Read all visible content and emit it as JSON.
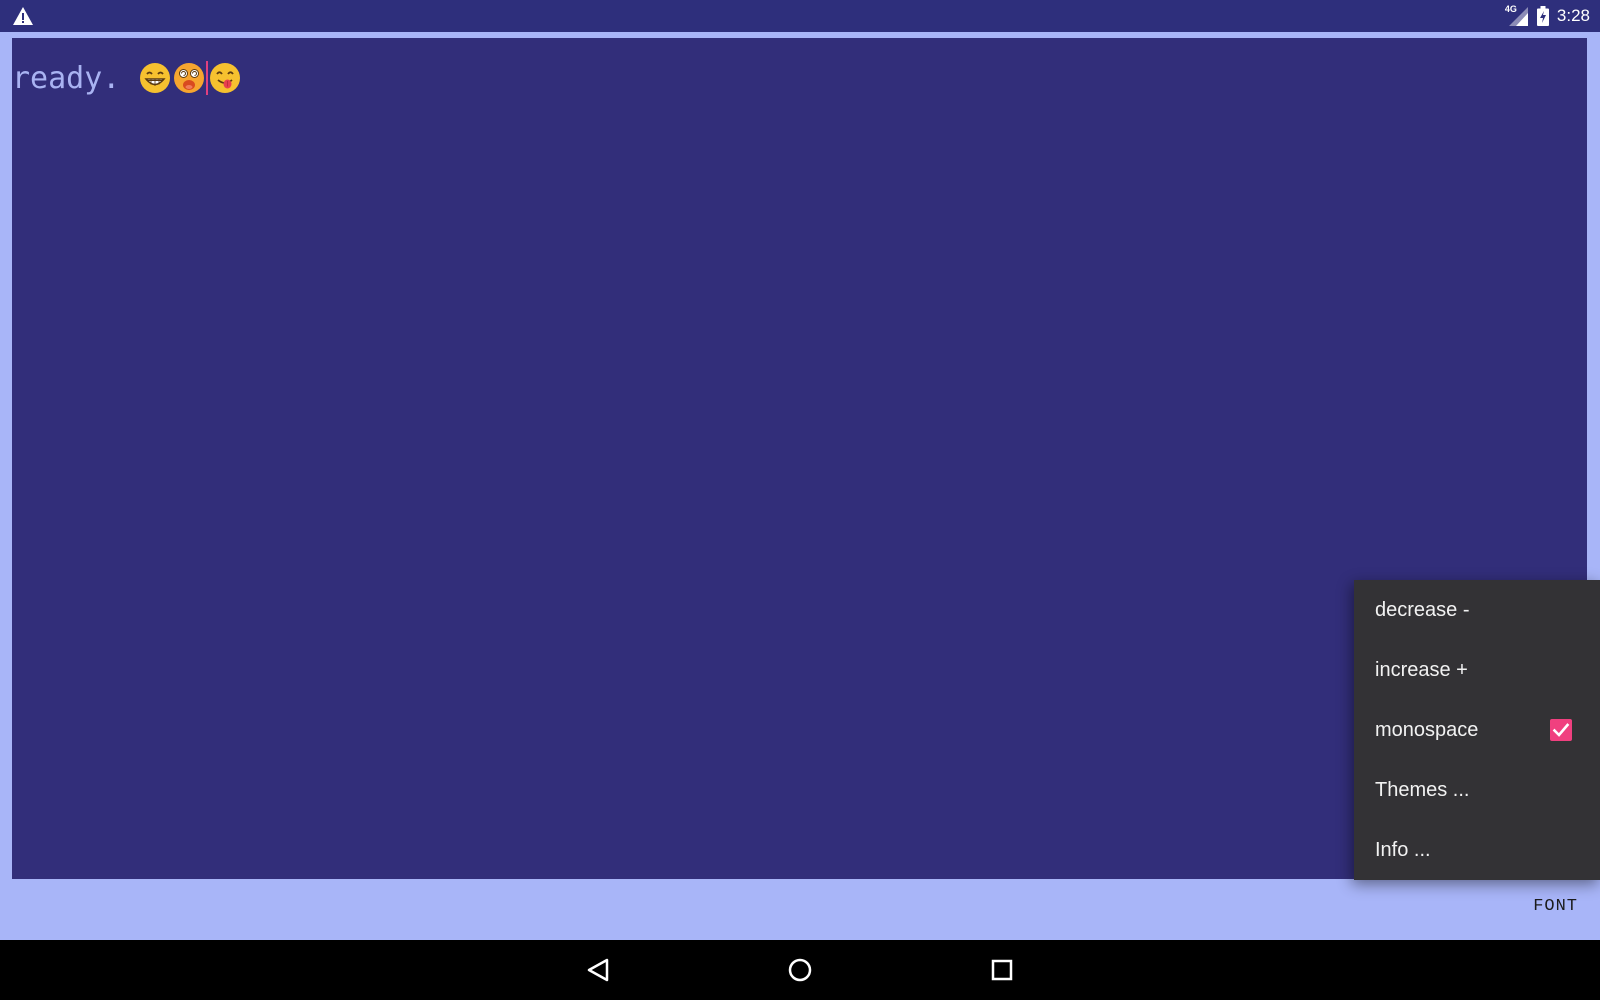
{
  "status_bar": {
    "warning_icon": "warning-triangle-icon",
    "network_label": "4G",
    "signal_icon": "cell-signal-icon",
    "battery_icon": "battery-charging-icon",
    "time": "3:28"
  },
  "editor": {
    "text": "ready. ",
    "emojis": [
      "grinning-face-icon",
      "dizzy-face-icon",
      "yum-face-icon"
    ]
  },
  "menu": {
    "items": [
      {
        "label": "decrease -"
      },
      {
        "label": "increase +"
      },
      {
        "label": "monospace",
        "checked": true
      },
      {
        "label": "Themes ..."
      },
      {
        "label": "Info ..."
      }
    ]
  },
  "toolbar": {
    "font_label": "FONT"
  },
  "nav_bar": {
    "back_icon": "back-triangle-icon",
    "home_icon": "home-circle-icon",
    "recents_icon": "recents-square-icon"
  },
  "colors": {
    "background": "#a8b5f8",
    "editor_bg": "#322e7a",
    "editor_text": "#a9b3f2",
    "accent": "#f0407f",
    "menu_bg": "#333235"
  }
}
